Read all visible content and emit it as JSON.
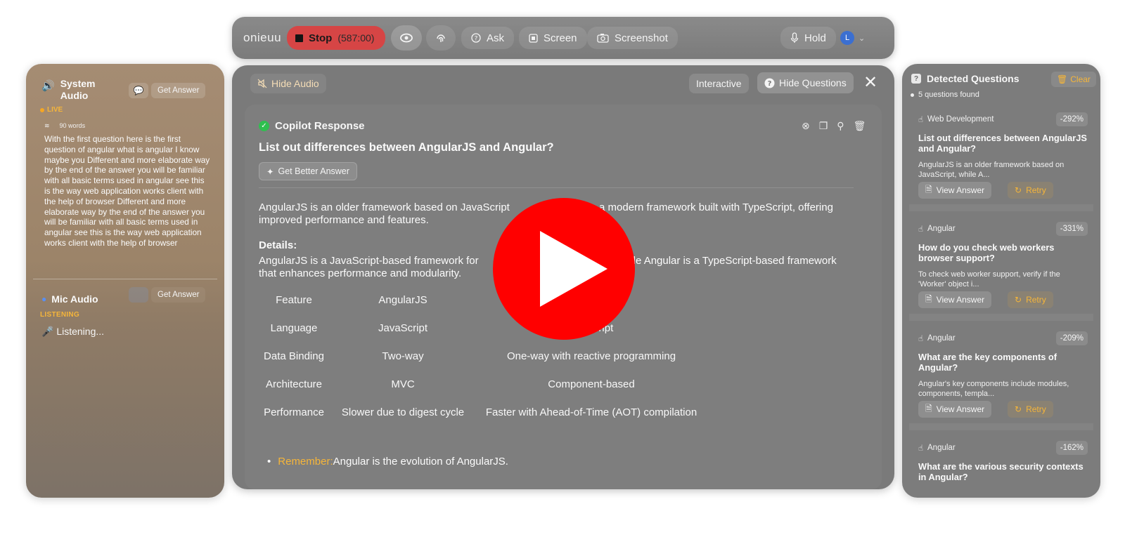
{
  "toolbar": {
    "logo": "onieuu",
    "stop_label": "Stop",
    "stop_timer": "(587:00)",
    "ask_label": "Ask",
    "screen_label": "Screen",
    "screenshot_label": "Screenshot",
    "hold_label": "Hold",
    "avatar_initial": "L"
  },
  "left_panel": {
    "system_audio_title": "System Audio",
    "get_answer_label": "Get Answer",
    "live_label": "LIVE",
    "word_count": "90 words",
    "transcript": "With the first question here is the first question of angular what is angular I know maybe you Different and more elaborate way by the end of the answer you will be familiar with all basic terms used in angular see this is the way web application works client with the help of browser Different and more elaborate way by the end of the answer you will be familiar with all basic terms used in angular see this is the way web application works client with the help of browser",
    "mic_audio_title": "Mic Audio",
    "mic_get_answer_label": "Get Answer",
    "listening_label": "LISTENING",
    "listening_text": "Listening..."
  },
  "center": {
    "hide_audio_label": "Hide Audio",
    "interactive_label": "Interactive",
    "hide_questions_label": "Hide Questions",
    "response_title": "Copilot Response",
    "question": "List out differences between AngularJS and Angular?",
    "better_answer_label": "Get Better Answer",
    "summary_left": "AngularJS is an older framework based on JavaScript",
    "summary_right": "a modern framework built with TypeScript, offering",
    "summary_line2": "improved performance and features.",
    "details_heading": "Details:",
    "details_left": "AngularJS is a JavaScript-based framework for",
    "details_right": "hile Angular is a TypeScript-based framework",
    "details_line2": "that enhances performance and modularity.",
    "table": {
      "headers": [
        "Feature",
        "AngularJS",
        ""
      ],
      "rows": [
        [
          "Language",
          "JavaScript",
          "ypeScript"
        ],
        [
          "Data Binding",
          "Two-way",
          "One-way with reactive programming"
        ],
        [
          "Architecture",
          "MVC",
          "Component-based"
        ],
        [
          "Performance",
          "Slower due to digest cycle",
          "Faster with Ahead-of-Time (AOT) compilation"
        ]
      ]
    },
    "remember_label": "Remember:",
    "remember_text": "Angular is the evolution of AngularJS."
  },
  "right_panel": {
    "title": "Detected Questions",
    "clear_label": "Clear",
    "found_text": "5 questions found",
    "view_answer_label": "View Answer",
    "retry_label": "Retry",
    "questions": [
      {
        "category": "Web Development",
        "score": "-292%",
        "question": "List out differences between AngularJS and Angular?",
        "answer": "AngularJS is an older framework based on JavaScript, while A..."
      },
      {
        "category": "Angular",
        "score": "-331%",
        "question": "How do you check web workers browser support?",
        "answer": "To check web worker support, verify if the 'Worker' object i..."
      },
      {
        "category": "Angular",
        "score": "-209%",
        "question": "What are the key components of Angular?",
        "answer": "Angular's key components include modules, components, templa..."
      },
      {
        "category": "Angular",
        "score": "-162%",
        "question": "What are the various security contexts in Angular?",
        "answer": ""
      }
    ]
  },
  "colors": {
    "stop": "#d64545",
    "accent": "#f5b53a",
    "play": "#ff0000",
    "check": "#2fbf4f"
  }
}
